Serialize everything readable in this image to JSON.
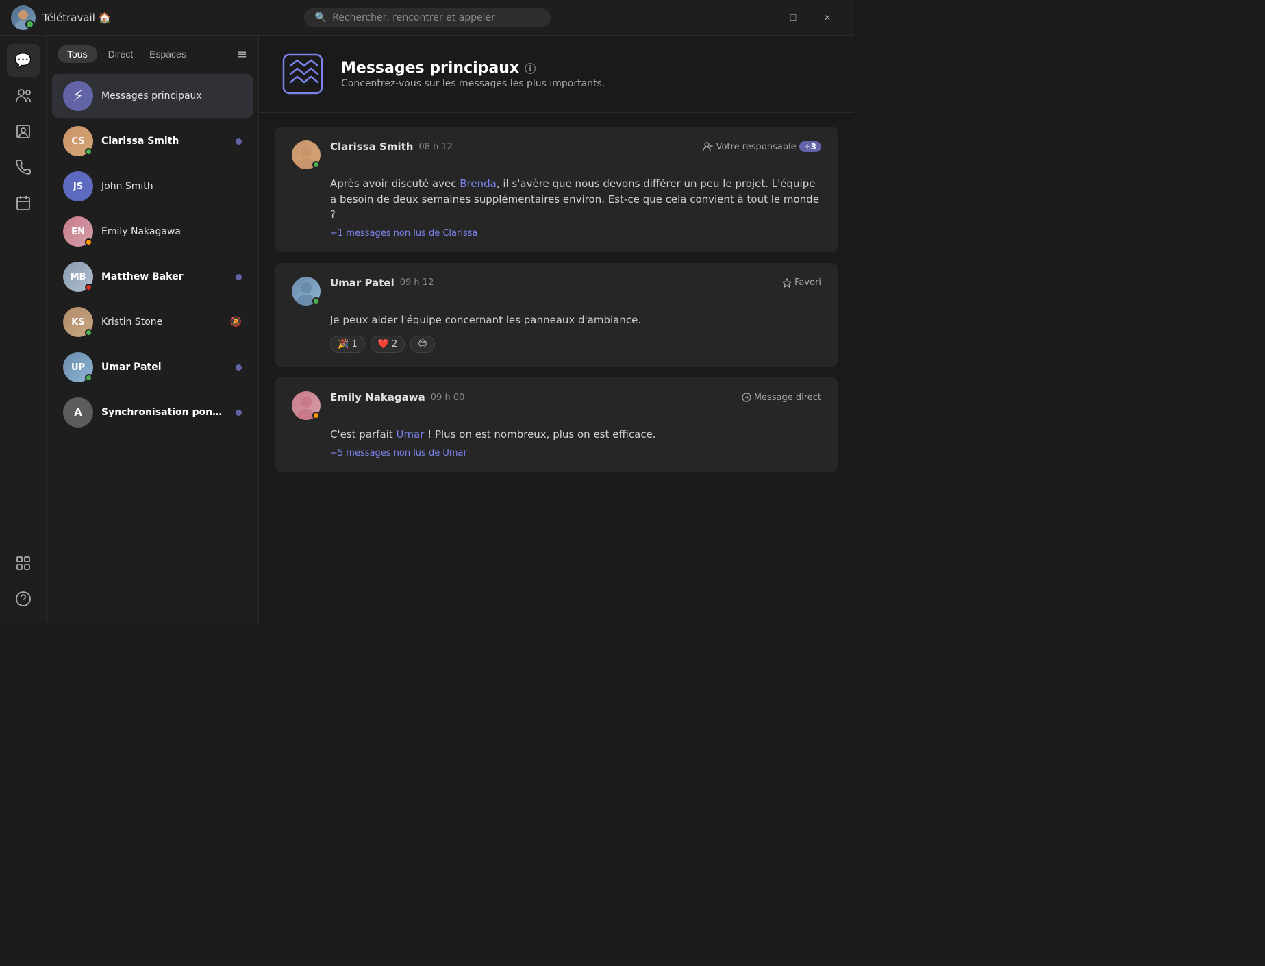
{
  "titleBar": {
    "appName": "Télétravail 🏠",
    "searchPlaceholder": "Rechercher, rencontrer et appeler",
    "minBtn": "—",
    "maxBtn": "☐",
    "closeBtn": "✕"
  },
  "sidebar": {
    "icons": [
      {
        "name": "chat",
        "symbol": "💬",
        "active": true
      },
      {
        "name": "people",
        "symbol": "👥",
        "active": false
      },
      {
        "name": "contacts",
        "symbol": "📋",
        "active": false
      },
      {
        "name": "calls",
        "symbol": "📞",
        "active": false
      },
      {
        "name": "calendar",
        "symbol": "📅",
        "active": false
      }
    ],
    "bottomIcons": [
      {
        "name": "apps",
        "symbol": "⊞",
        "active": false
      },
      {
        "name": "help",
        "symbol": "?",
        "active": false
      }
    ]
  },
  "chatList": {
    "filters": {
      "all": "Tous",
      "direct": "Direct",
      "spaces": "Espaces"
    },
    "items": [
      {
        "id": "messages-principaux",
        "name": "Messages principaux",
        "type": "lightning",
        "bold": false,
        "active": true,
        "hasUnread": false,
        "muted": false
      },
      {
        "id": "clarissa-smith",
        "name": "Clarissa Smith",
        "type": "avatar",
        "avatarClass": "face-clarissa",
        "initials": "CS",
        "bold": true,
        "active": false,
        "hasUnread": true,
        "statusClass": "status-online",
        "muted": false
      },
      {
        "id": "john-smith",
        "name": "John Smith",
        "type": "initials",
        "initials": "JS",
        "bold": false,
        "active": false,
        "hasUnread": false,
        "statusClass": "status-offline",
        "muted": false
      },
      {
        "id": "emily-nakagawa",
        "name": "Emily Nakagawa",
        "type": "avatar",
        "avatarClass": "face-emily",
        "initials": "EN",
        "bold": false,
        "active": false,
        "hasUnread": false,
        "statusClass": "status-away",
        "muted": false
      },
      {
        "id": "matthew-baker",
        "name": "Matthew Baker",
        "type": "avatar",
        "avatarClass": "face-matthew",
        "initials": "MB",
        "bold": true,
        "active": false,
        "hasUnread": true,
        "statusClass": "status-busy",
        "muted": false
      },
      {
        "id": "kristin-stone",
        "name": "Kristin Stone",
        "type": "avatar",
        "avatarClass": "face-kristin",
        "initials": "KS",
        "bold": false,
        "active": false,
        "hasUnread": false,
        "statusClass": "status-online",
        "muted": true
      },
      {
        "id": "umar-patel",
        "name": "Umar Patel",
        "type": "avatar",
        "avatarClass": "face-umar",
        "initials": "UP",
        "bold": true,
        "active": false,
        "hasUnread": true,
        "statusClass": "status-online",
        "muted": false
      },
      {
        "id": "synchronisation-ponctuelle",
        "name": "Synchronisation ponctuelle",
        "type": "initials",
        "initials": "A",
        "avatarClass": "face-sync",
        "bold": true,
        "active": false,
        "hasUnread": true,
        "statusClass": "",
        "muted": false
      }
    ]
  },
  "channel": {
    "title": "Messages principaux",
    "infoLabel": "ℹ",
    "subtitle": "Concentrez-vous sur les messages les plus importants."
  },
  "messages": [
    {
      "id": "msg-clarissa",
      "sender": "Clarissa Smith",
      "time": "08 h 12",
      "avatarClass": "face-clarissa",
      "statusClass": "status-online",
      "badgeLabel": "Votre responsable",
      "badgeCount": "+3",
      "text": "Après avoir discuté avec {Brenda}, il s'avère que nous devons différer un peu le projet. L'équipe a besoin de deux semaines supplémentaires environ. Est-ce que cela convient à tout le monde ?",
      "mention": "Brenda",
      "unreadNote": "+1 messages non lus de Clarissa",
      "reactions": [],
      "actionLabel": ""
    },
    {
      "id": "msg-umar",
      "sender": "Umar Patel",
      "time": "09 h 12",
      "avatarClass": "face-umar",
      "statusClass": "status-online",
      "badgeLabel": "",
      "badgeCount": "",
      "text": "Je peux aider l'équipe concernant les panneaux d'ambiance.",
      "mention": "",
      "unreadNote": "",
      "reactions": [
        {
          "emoji": "🎉",
          "count": "1"
        },
        {
          "emoji": "❤️",
          "count": "2"
        },
        {
          "emoji": "😊",
          "count": ""
        }
      ],
      "actionLabel": "Favori"
    },
    {
      "id": "msg-emily",
      "sender": "Emily Nakagawa",
      "time": "09 h 00",
      "avatarClass": "face-emily",
      "statusClass": "status-away",
      "badgeLabel": "",
      "badgeCount": "",
      "text": "C'est parfait {Umar} ! Plus on est nombreux, plus on est efficace.",
      "mention": "Umar",
      "unreadNote": "+5 messages non lus de Umar",
      "reactions": [],
      "actionLabel": "Message direct"
    }
  ]
}
